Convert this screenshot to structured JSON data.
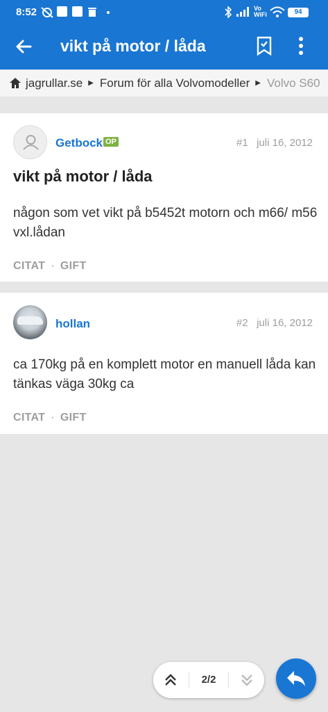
{
  "status_bar": {
    "time": "8:52",
    "wifi_label": "Vo\nWiFi",
    "battery": "94"
  },
  "app_bar": {
    "title": "vikt på motor / låda"
  },
  "breadcrumbs": [
    "jagrullar.se",
    "Forum för alla Volvomodeller",
    "Volvo S60"
  ],
  "posts": [
    {
      "author": "Getbock",
      "op_badge": "OP",
      "number": "#1",
      "date": "juli 16, 2012",
      "title": "vikt på motor / låda",
      "body": "någon som vet vikt på b5452t motorn och m66/ m56 vxl.lådan",
      "actions": [
        "CITAT",
        "GIFT"
      ]
    },
    {
      "author": "hollan",
      "number": "#2",
      "date": "juli 16, 2012",
      "body": "ca 170kg på en komplett motor en manuell låda kan tänkas väga 30kg ca",
      "actions": [
        "CITAT",
        "GIFT"
      ]
    }
  ],
  "pager": {
    "label": "2/2"
  },
  "colors": {
    "primary": "#1976d2",
    "op_badge": "#7cb342",
    "background": "#e6e6e6"
  }
}
